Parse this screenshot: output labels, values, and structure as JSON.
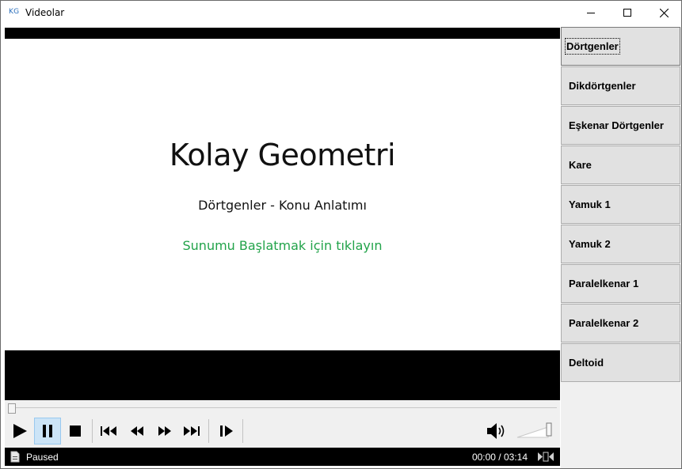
{
  "window": {
    "app_icon_text": "KG",
    "title": "Videolar",
    "controls": {
      "minimize": "minimize-icon",
      "maximize": "maximize-icon",
      "close": "close-icon"
    }
  },
  "slide": {
    "title": "Kolay Geometri",
    "subtitle": "Dörtgenler - Konu Anlatımı",
    "link": "Sunumu Başlatmak için tıklayın",
    "link_color": "#22a34a"
  },
  "player": {
    "seek_progress": 0.0,
    "volume_level": 1.0,
    "state": "paused",
    "buttons": [
      "play-icon",
      "pause-icon",
      "stop-icon",
      "previous-track-icon",
      "rewind-icon",
      "fast-forward-icon",
      "next-track-icon",
      "frame-step-icon",
      "volume-icon"
    ]
  },
  "status": {
    "text": "Paused",
    "time": "00:00 / 03:14"
  },
  "sidebar": {
    "items": [
      {
        "label": "Dörtgenler"
      },
      {
        "label": "Dikdörtgenler"
      },
      {
        "label": "Eşkenar Dörtgenler"
      },
      {
        "label": "Kare"
      },
      {
        "label": "Yamuk 1"
      },
      {
        "label": "Yamuk 2"
      },
      {
        "label": "Paralelkenar 1"
      },
      {
        "label": "Paralelkenar 2"
      },
      {
        "label": "Deltoid"
      }
    ]
  }
}
